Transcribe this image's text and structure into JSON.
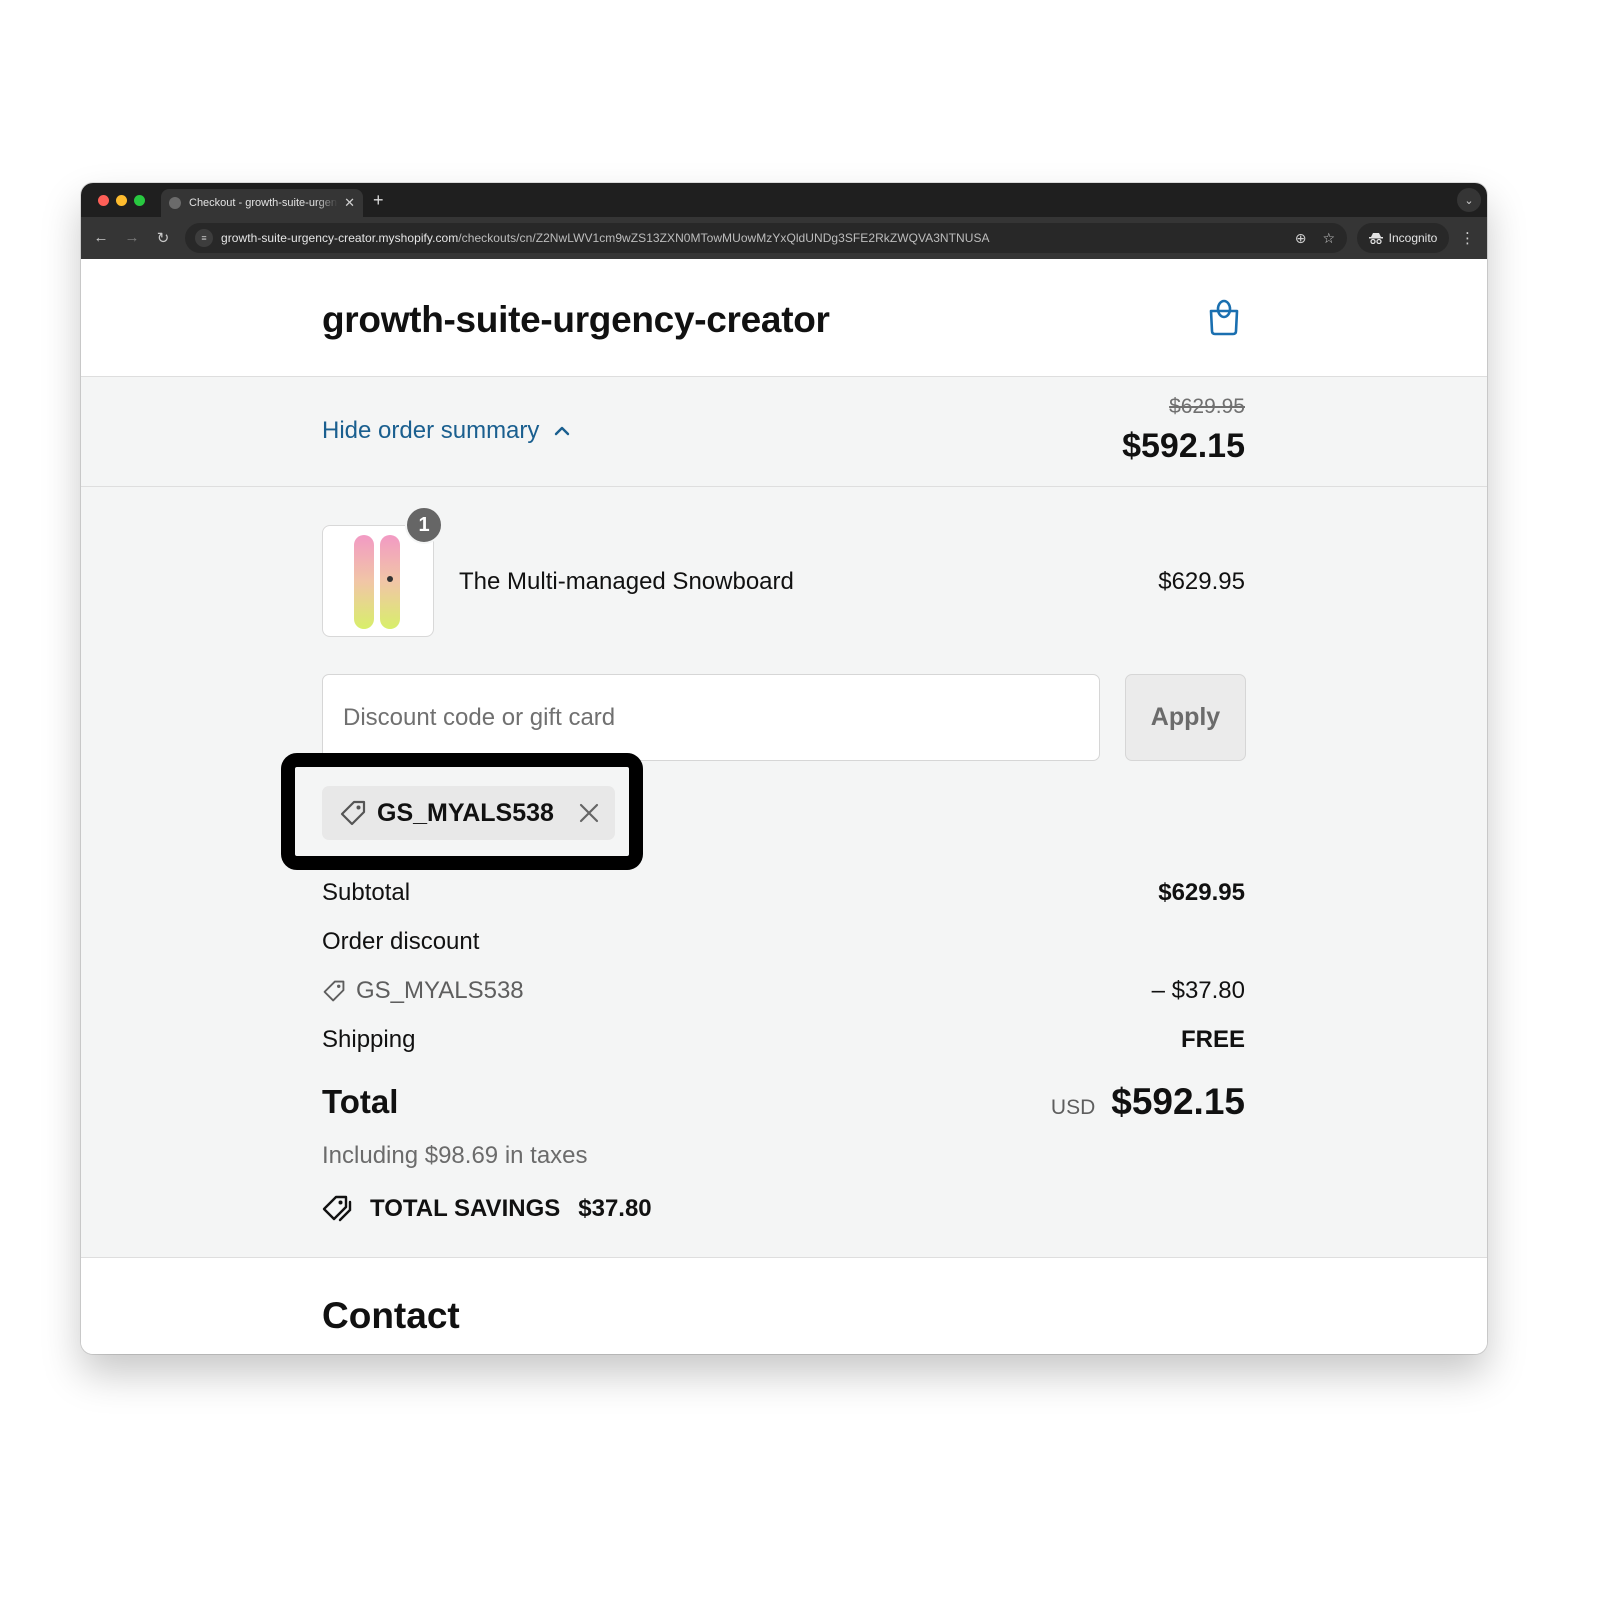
{
  "browser": {
    "tab_title": "Checkout - growth-suite-urgency-creator",
    "tab_close": "✕",
    "new_tab": "+",
    "tab_menu": "⌄",
    "nav": {
      "back": "←",
      "forward": "→",
      "reload": "↻"
    },
    "url_host": "growth-suite-urgency-creator.myshopify.com",
    "url_path": "/checkouts/cn/Z2NwLWV1cm9wZS13ZXN0MTowMUowMzYxQldUNDg3SFE2RkZWQVA3NTNUSA",
    "zoom_icon": "⊕",
    "bookmark_icon": "☆",
    "incognito_label": "Incognito",
    "menu_icon": "⋮"
  },
  "header": {
    "shop_name": "growth-suite-urgency-creator",
    "accent_color": "#1a5f8f"
  },
  "summary_toggle": {
    "label": "Hide order summary",
    "original_price": "$629.95",
    "current_price": "$592.15"
  },
  "order": {
    "items": [
      {
        "name": "The Multi-managed Snowboard",
        "price": "$629.95",
        "quantity": "1"
      }
    ],
    "discount_input": {
      "placeholder": "Discount code or gift card",
      "value": ""
    },
    "apply_label": "Apply",
    "applied_code": {
      "code": "GS_MYALS538",
      "remove": "✕"
    },
    "subtotal": {
      "label": "Subtotal",
      "value": "$629.95"
    },
    "order_discount": {
      "label": "Order discount",
      "code": "GS_MYALS538",
      "value": "– $37.80"
    },
    "shipping": {
      "label": "Shipping",
      "value": "FREE"
    },
    "total": {
      "label": "Total",
      "currency": "USD",
      "value": "$592.15"
    },
    "taxes_note": "Including $98.69 in taxes",
    "savings": {
      "label": "TOTAL SAVINGS",
      "value": "$37.80"
    }
  },
  "contact": {
    "heading": "Contact"
  }
}
